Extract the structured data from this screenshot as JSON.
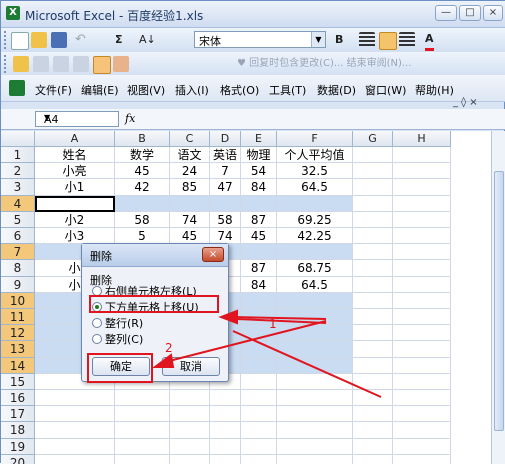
{
  "window": {
    "title": "Microsoft Excel - 百度经验1.xls",
    "app_icon": "X"
  },
  "window_controls": {
    "minimize": "—",
    "restore": "□",
    "close": "×"
  },
  "toolbar1": {
    "sigma": "Σ",
    "sort": "A↓",
    "font": "宋体",
    "bold": "B",
    "font_color_letter": "A"
  },
  "toolbar2": {
    "reply_text": "♥ 回复时包含更改(C)...  结束审阅(N)..."
  },
  "menu": {
    "items": [
      "文件(F)",
      "编辑(E)",
      "视图(V)",
      "插入(I)",
      "格式(O)",
      "工具(T)",
      "数据(D)",
      "窗口(W)",
      "帮助(H)"
    ],
    "controls": "_ ◊ ×"
  },
  "formula_bar": {
    "name_box": "A4",
    "fx": "fx"
  },
  "columns": [
    "A",
    "B",
    "C",
    "D",
    "E",
    "F",
    "G",
    "H"
  ],
  "rows": [
    "1",
    "2",
    "3",
    "4",
    "5",
    "6",
    "7",
    "8",
    "9",
    "10",
    "11",
    "12",
    "13",
    "14",
    "15",
    "16",
    "17",
    "18",
    "19",
    "20"
  ],
  "table": [
    [
      "姓名",
      "数学",
      "语文",
      "英语",
      "物理",
      "个人平均值"
    ],
    [
      "小亮",
      "45",
      "24",
      "7",
      "54",
      "32.5"
    ],
    [
      "小1",
      "42",
      "85",
      "47",
      "84",
      "64.5"
    ],
    [
      "",
      "",
      "",
      "",
      "",
      ""
    ],
    [
      "小2",
      "58",
      "74",
      "58",
      "87",
      "69.25"
    ],
    [
      "小3",
      "5",
      "45",
      "74",
      "45",
      "42.25"
    ],
    [
      "",
      "",
      "",
      "",
      "",
      ""
    ],
    [
      "小",
      "",
      "",
      "7",
      "87",
      "68.75"
    ],
    [
      "小",
      "",
      "",
      "7",
      "84",
      "64.5"
    ]
  ],
  "dialog": {
    "title": "删除",
    "close": "×",
    "group_label": "删除",
    "options": [
      "右侧单元格左移(L)",
      "下方单元格上移(U)",
      "整行(R)",
      "整列(C)"
    ],
    "selected_index": 1,
    "ok": "确定",
    "cancel": "取消"
  },
  "annotations": {
    "step1": "1",
    "step2": "2"
  },
  "colors": {
    "accent_red": "#e0151f",
    "selection": "#c9dcf2"
  }
}
